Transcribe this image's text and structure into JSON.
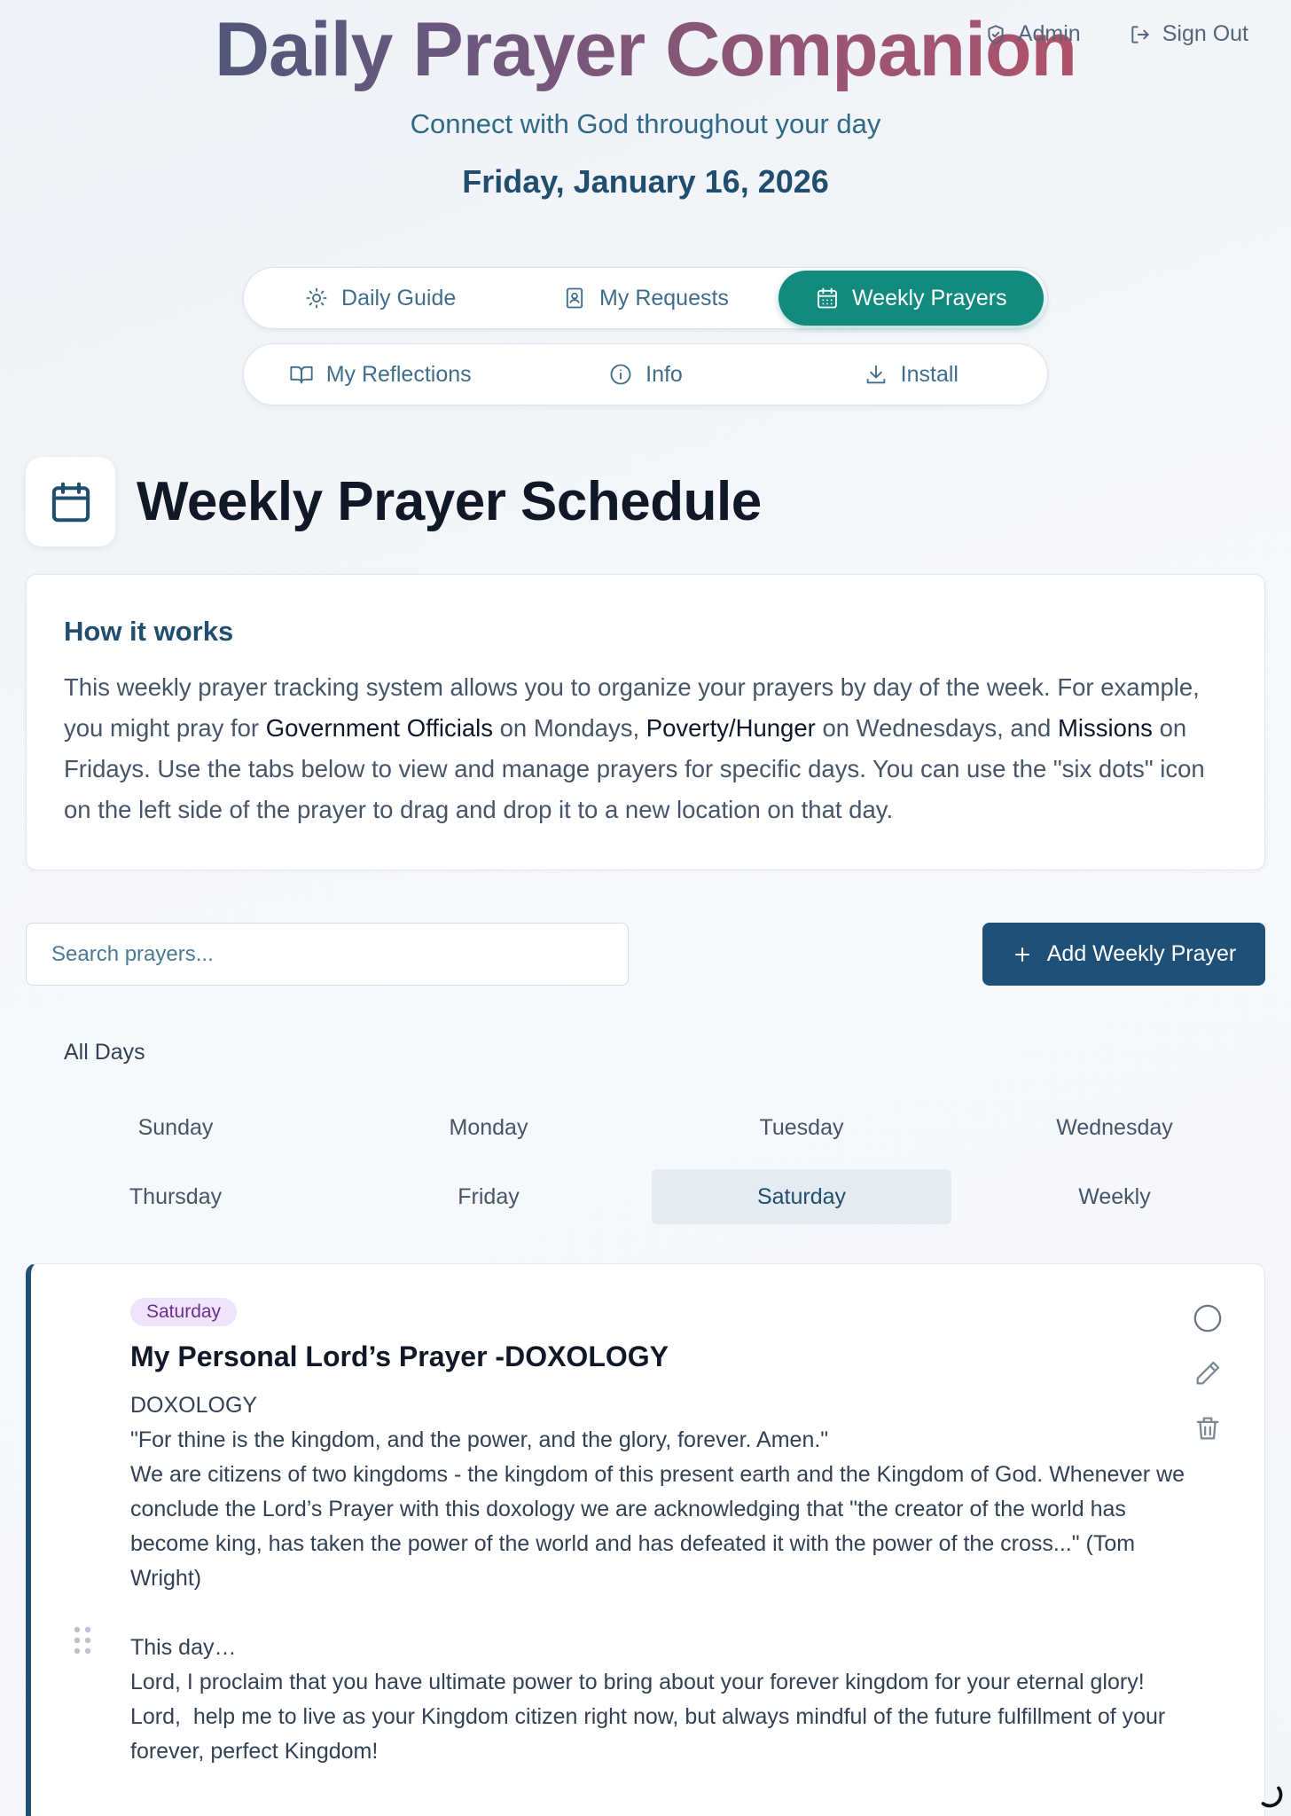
{
  "top_actions": {
    "admin_label": "Admin",
    "signout_label": "Sign Out"
  },
  "header": {
    "title": "Daily Prayer Companion",
    "tagline": "Connect with God throughout your day",
    "date": "Friday, January 16, 2026"
  },
  "nav": {
    "row1": [
      {
        "label": "Daily Guide",
        "icon": "sun-icon"
      },
      {
        "label": "My Requests",
        "icon": "book-person-icon"
      },
      {
        "label": "Weekly Prayers",
        "icon": "calendar-icon",
        "active": true
      }
    ],
    "row2": [
      {
        "label": "My Reflections",
        "icon": "open-book-icon"
      },
      {
        "label": "Info",
        "icon": "info-icon"
      },
      {
        "label": "Install",
        "icon": "download-icon"
      }
    ]
  },
  "section": {
    "title": "Weekly Prayer Schedule"
  },
  "how_it_works": {
    "title": "How it works",
    "text_1": "This weekly prayer tracking system allows you to organize your prayers by day of the week. For example, you might pray for ",
    "highlight_1": "Government Officials",
    "text_2": " on Mondays, ",
    "highlight_2": "Poverty/Hunger",
    "text_3": " on Wednesdays, and ",
    "highlight_3": "Missions",
    "text_4": " on Fridays. Use the tabs below to view and manage prayers for specific days. You can use the \"six dots\" icon on the left side of the prayer to drag and drop it to a new location on that day."
  },
  "search": {
    "placeholder": "Search prayers..."
  },
  "add_button": {
    "label": "Add Weekly Prayer"
  },
  "day_tabs": {
    "all_label": "All Days",
    "days": [
      "Sunday",
      "Monday",
      "Tuesday",
      "Wednesday",
      "Thursday",
      "Friday",
      "Saturday",
      "Weekly"
    ],
    "active": "Saturday"
  },
  "prayer": {
    "badge": "Saturday",
    "title": "My Personal Lord’s Prayer -DOXOLOGY",
    "body_1": "DOXOLOGY\n\"For thine is the kingdom, and the power, and the glory, forever. Amen.\"\nWe are citizens of two kingdoms - the kingdom of this present earth and the Kingdom of God. Whenever we conclude the Lord’s Prayer with this doxology we are acknowledging that \"the creator of the world has become king, has taken the power of the world and has defeated it with the power of the cross...\" (Tom Wright)",
    "body_2": "This day…\nLord, I proclaim that you have ultimate power to bring about your forever kingdom for your eternal glory!\nLord,  help me to live as your Kingdom citizen right now, but always mindful of the future fulfillment of your forever, perfect Kingdom!"
  },
  "colors": {
    "accent_teal": "#128a7e",
    "primary_blue": "#1f5178",
    "badge_bg": "#f0e4fa",
    "badge_text": "#6b2f8f"
  }
}
